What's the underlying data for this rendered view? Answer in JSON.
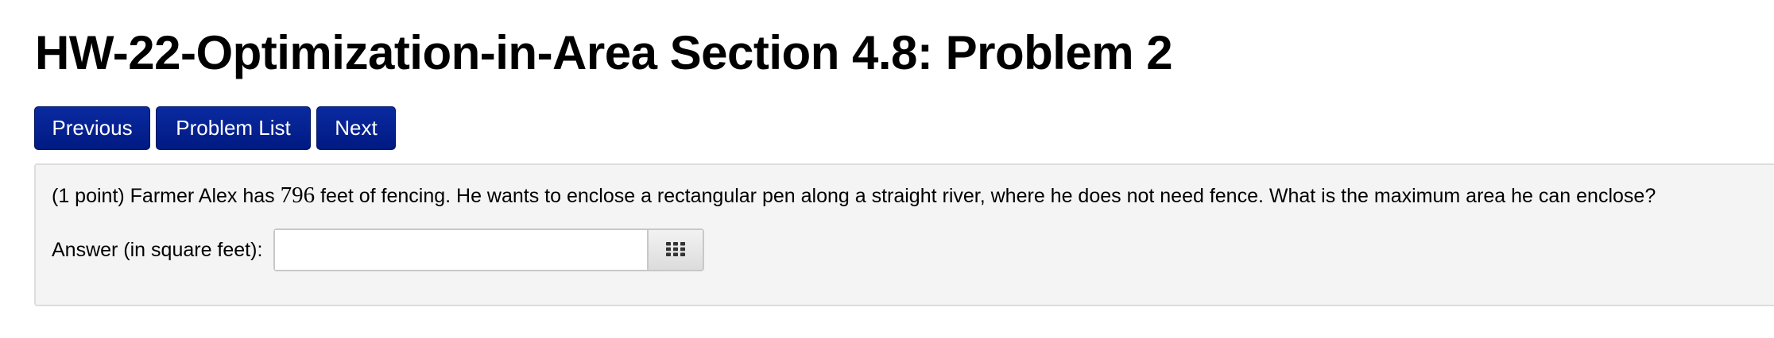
{
  "header": {
    "title": "HW-22-Optimization-in-Area Section 4.8: Problem 2"
  },
  "nav": {
    "previous_label": "Previous",
    "problem_list_label": "Problem List",
    "next_label": "Next"
  },
  "problem": {
    "points": "(1 point)",
    "text_before": " Farmer Alex has ",
    "fencing_amount": "796",
    "text_after": " feet of fencing. He wants to enclose a rectangular pen along a straight river, where he does not need fence. What is the maximum area he can enclose?",
    "answer_label": "Answer (in square feet):",
    "answer_value": "",
    "answer_placeholder": "",
    "palette_icon": "grid-icon"
  },
  "colors": {
    "button_bg": "#0a2aa0",
    "panel_bg": "#f4f4f4"
  }
}
